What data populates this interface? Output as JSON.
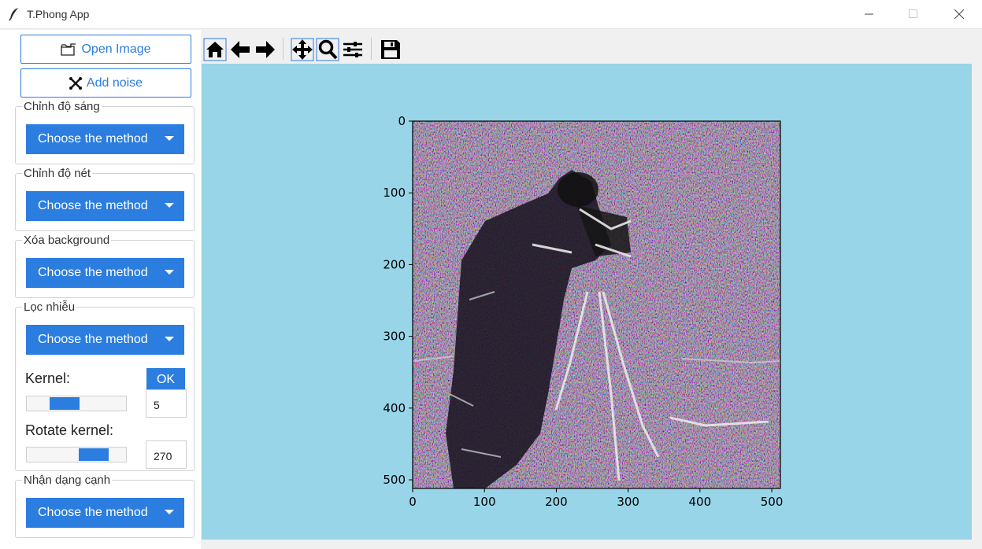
{
  "window": {
    "title": "T.Phong App"
  },
  "sidebar": {
    "open_image_label": "Open Image",
    "add_noise_label": "Add noise",
    "groups": [
      {
        "label": "Chỉnh độ sáng",
        "dropdown": "Choose the method"
      },
      {
        "label": "Chỉnh độ nét",
        "dropdown": "Choose the method"
      },
      {
        "label": "Xóa background",
        "dropdown": "Choose the method"
      },
      {
        "label": "Lọc nhiễu",
        "dropdown": "Choose the method"
      },
      {
        "label": "Nhận dạng cạnh",
        "dropdown": "Choose the method"
      }
    ],
    "filter": {
      "kernel_label": "Kernel:",
      "ok_label": "OK",
      "kernel_value": "5",
      "kernel_slider_fraction": 0.35,
      "rotate_label": "Rotate kernel:",
      "rotate_value": "270",
      "rotate_slider_fraction": 0.75
    }
  },
  "toolbar": {
    "icons": [
      "home-icon",
      "back-icon",
      "forward-icon",
      "pan-icon",
      "zoom-icon",
      "configure-subplots-icon",
      "save-icon"
    ]
  },
  "colors": {
    "accent": "#2b7de0",
    "plot_background": "#98d5e8"
  },
  "chart_data": {
    "type": "image",
    "xlim": [
      0,
      512
    ],
    "ylim": [
      512,
      0
    ],
    "x_ticks": [
      "0",
      "100",
      "200",
      "300",
      "400",
      "500"
    ],
    "y_ticks": [
      "0",
      "100",
      "200",
      "300",
      "400",
      "500"
    ]
  }
}
